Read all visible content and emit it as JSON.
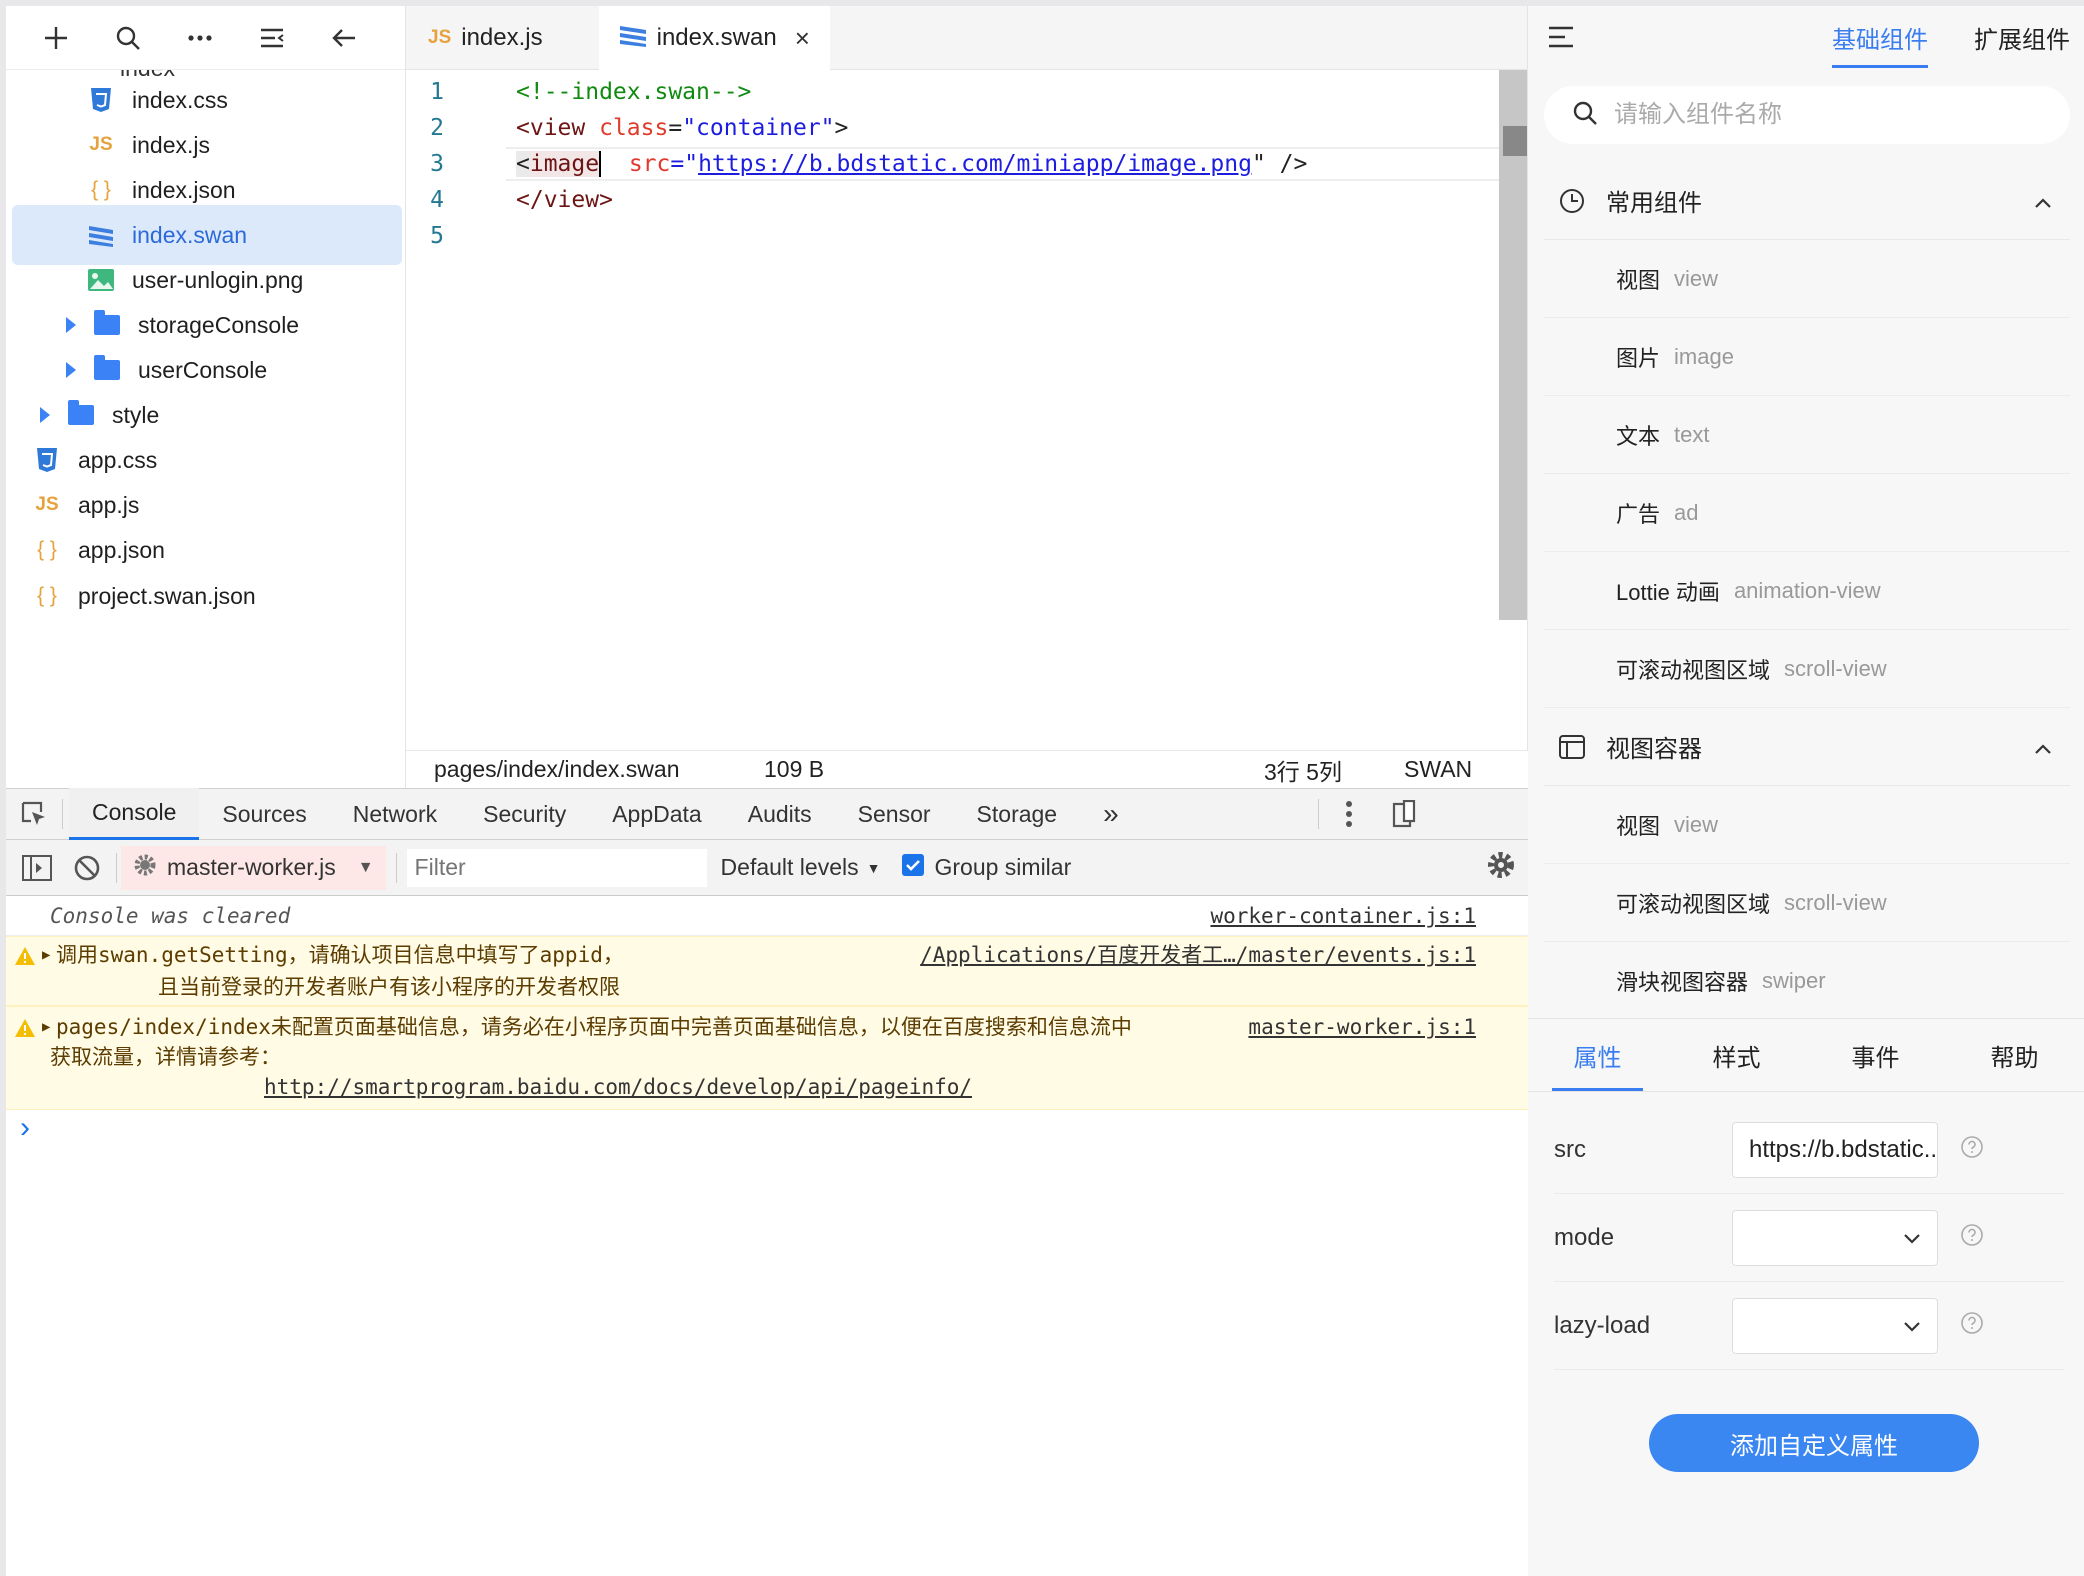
{
  "tree": {
    "partial_top": "index",
    "items": [
      {
        "name": "index.css",
        "icon": "css-icon"
      },
      {
        "name": "index.js",
        "icon": "js-icon"
      },
      {
        "name": "index.json",
        "icon": "json-icon"
      },
      {
        "name": "index.swan",
        "icon": "swan-icon",
        "selected": true
      },
      {
        "name": "user-unlogin.png",
        "icon": "image-icon"
      },
      {
        "name": "storageConsole",
        "icon": "folder-icon"
      },
      {
        "name": "userConsole",
        "icon": "folder-icon"
      },
      {
        "name": "style",
        "icon": "folder-icon"
      },
      {
        "name": "app.css",
        "icon": "css-icon"
      },
      {
        "name": "app.js",
        "icon": "js-icon"
      },
      {
        "name": "app.json",
        "icon": "json-icon"
      },
      {
        "name": "project.swan.json",
        "icon": "json-icon"
      }
    ]
  },
  "editor": {
    "tabs": [
      {
        "label": "index.js",
        "icon": "js-icon"
      },
      {
        "label": "index.swan",
        "icon": "swan-icon",
        "active": true,
        "close": "×"
      }
    ],
    "line_numbers": [
      "1",
      "2",
      "3",
      "4",
      "5"
    ],
    "code": {
      "l1": "<!--index.swan-->",
      "l2_open": "<view ",
      "l2_attr": "class",
      "l2_eq": "=",
      "l2_val": "\"container\"",
      "l2_close": ">",
      "l3_open": "<",
      "l3_tag": "image",
      "l3_attr": "src",
      "l3_eq": "=\"",
      "l3_url": "https://b.bdstatic.com/miniapp/image.png",
      "l3_end": "\" />",
      "l4": "</view>"
    },
    "status": {
      "path": "pages/index/index.swan",
      "size": "109 B",
      "position": "3行 5列",
      "lang": "SWAN"
    }
  },
  "devtools": {
    "tabs": [
      "Console",
      "Sources",
      "Network",
      "Security",
      "AppData",
      "Audits",
      "Sensor",
      "Storage"
    ],
    "more": "»",
    "context": "master-worker.js",
    "filter_placeholder": "Filter",
    "levels": "Default levels",
    "group_similar": "Group similar",
    "messages": {
      "cleared": "Console was cleared",
      "cleared_src": "worker-container.js:1",
      "w1_l1": "调用swan.getSetting，请确认项目信息中填写了appid，",
      "w1_l2": "且当前登录的开发者账户有该小程序的开发者权限",
      "w1_src": "/Applications/百度开发者工…/master/events.js:1",
      "w2_l1": "pages/index/index未配置页面基础信息，请务必在小程序页面中完善页面基础信息，以便在百度搜索和信息流中",
      "w2_l2": "获取流量，详情请参考：",
      "w2_link": "http://smartprogram.baidu.com/docs/develop/api/pageinfo/",
      "w2_src": "master-worker.js:1",
      "prompt": "›"
    }
  },
  "panel": {
    "tab_basic": "基础组件",
    "tab_ext": "扩展组件",
    "search_placeholder": "请输入组件名称",
    "sec1": "常用组件",
    "sec1_items": [
      {
        "zh": "视图",
        "en": "view"
      },
      {
        "zh": "图片",
        "en": "image"
      },
      {
        "zh": "文本",
        "en": "text"
      },
      {
        "zh": "广告",
        "en": "ad"
      },
      {
        "zh": "Lottie 动画",
        "en": "animation-view"
      },
      {
        "zh": "可滚动视图区域",
        "en": "scroll-view"
      }
    ],
    "sec2": "视图容器",
    "sec2_items": [
      {
        "zh": "视图",
        "en": "view"
      },
      {
        "zh": "可滚动视图区域",
        "en": "scroll-view"
      },
      {
        "zh": "滑块视图容器",
        "en": "swiper"
      }
    ],
    "attr_tabs": [
      "属性",
      "样式",
      "事件",
      "帮助"
    ],
    "props": {
      "src_label": "src",
      "src_value": "https://b.bdstatic....",
      "mode_label": "mode",
      "mode_value": "",
      "lazy_label": "lazy-load",
      "lazy_value": ""
    },
    "add_button": "添加自定义属性"
  },
  "colors": {
    "accent": "#3a87f2",
    "selection": "#dce9fb",
    "warning_bg": "#fffbe5"
  }
}
